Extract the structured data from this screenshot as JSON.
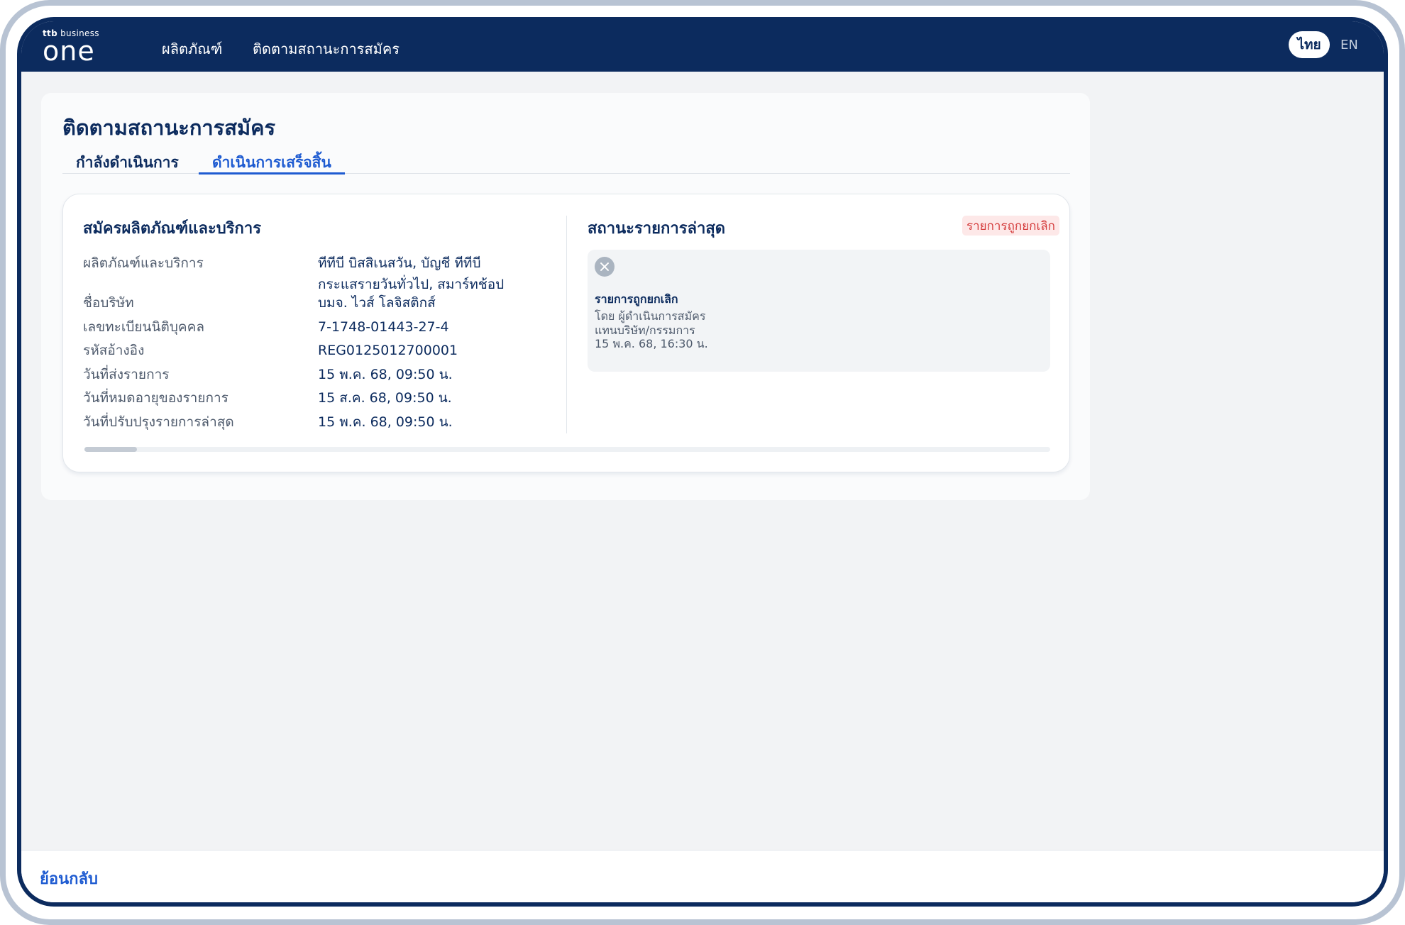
{
  "header": {
    "logo_small_brand": "ttb",
    "logo_small_text": "business",
    "logo_text": "one",
    "nav": [
      "ผลิตภัณฑ์",
      "ติดตามสถานะการสมัคร"
    ],
    "lang_active": "ไทย",
    "lang_other": "EN"
  },
  "page": {
    "title": "ติดตามสถานะการสมัคร",
    "tabs": [
      {
        "label": "กำลังดำเนินการ",
        "active": false
      },
      {
        "label": "ดำเนินการเสร็จสิ้น",
        "active": true
      }
    ]
  },
  "application": {
    "title": "สมัครผลิตภัณฑ์และบริการ",
    "rows": [
      {
        "label": "ผลิตภัณฑ์และบริการ",
        "value_line1": "ทีทีบี บิสสิเนสวัน, บัญชี ทีทีบี",
        "value_line2": "กระแสรายวันทั่วไป, สมาร์ทช้อป"
      },
      {
        "label": "ชื่อบริษัท",
        "value": "บมจ. ไวส์ โลจิสติกส์"
      },
      {
        "label": "เลขทะเบียนนิติบุคคล",
        "value": "7-1748-01443-27-4"
      },
      {
        "label": "รหัสอ้างอิง",
        "value": "REG0125012700001"
      },
      {
        "label": "วันที่ส่งรายการ",
        "value": "15 พ.ค. 68, 09:50 น."
      },
      {
        "label": "วันที่หมดอายุของรายการ",
        "value": "15 ส.ค. 68, 09:50 น."
      },
      {
        "label": "วันที่ปรับปรุงรายการล่าสุด",
        "value": "15 พ.ค. 68, 09:50 น."
      }
    ]
  },
  "status": {
    "title": "สถานะรายการล่าสุด",
    "badge": "รายการถูกยกเลิก",
    "icon": "close-circle-icon",
    "heading": "รายการถูกยกเลิก",
    "by": "โดย ผู้ดำเนินการสมัคร",
    "on_behalf": "แทนบริษัท/กรรมการ",
    "time": "15 พ.ค. 68, 16:30 น."
  },
  "footer": {
    "back_label": "ย้อนกลับ"
  },
  "colors": {
    "brand_navy": "#0c2b5e",
    "link_blue": "#1e5bd1",
    "cancel_red": "#d43a3a",
    "cancel_bg": "#fde8e8"
  }
}
